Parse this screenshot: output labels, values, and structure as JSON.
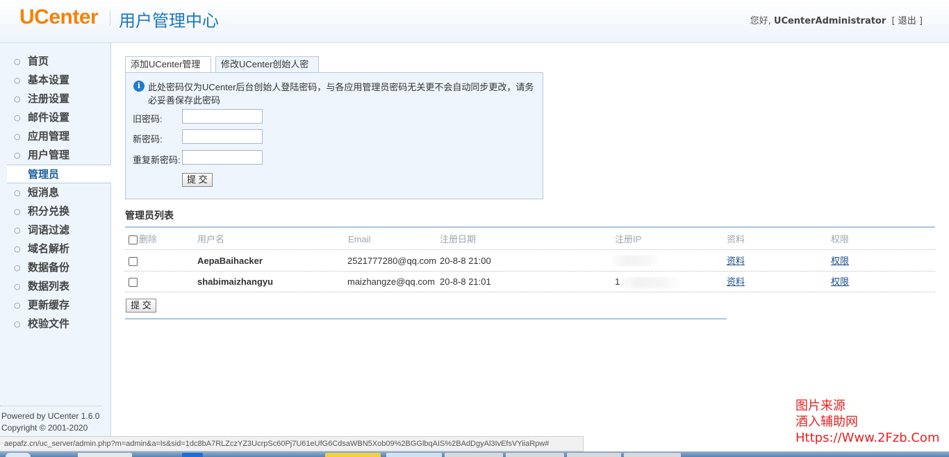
{
  "header": {
    "logo": "UCenter",
    "title": "用户管理中心",
    "greeting": "您好,",
    "username": "UCenterAdministrator",
    "logout_open": "[",
    "logout_label": "退出",
    "logout_close": "]"
  },
  "sidebar": {
    "items": [
      {
        "label": "首页"
      },
      {
        "label": "基本设置"
      },
      {
        "label": "注册设置"
      },
      {
        "label": "邮件设置"
      },
      {
        "label": "应用管理"
      },
      {
        "label": "用户管理"
      },
      {
        "label": "管理员",
        "active": true
      },
      {
        "label": "短消息"
      },
      {
        "label": "积分兑换"
      },
      {
        "label": "词语过滤"
      },
      {
        "label": "域名解析"
      },
      {
        "label": "数据备份"
      },
      {
        "label": "数据列表"
      },
      {
        "label": "更新缓存"
      },
      {
        "label": "校验文件"
      }
    ],
    "powered": "Powered by UCenter 1.6.0",
    "copyright": "Copyright © 2001-2020"
  },
  "tabs": {
    "add_admin": "添加UCenter管理员",
    "change_password": "修改UCenter创始人密码"
  },
  "password_form": {
    "notice": "此处密码仅为UCenter后台创始人登陆密码，与各应用管理员密码无关更不会自动同步更改，请务必妥善保存此密码",
    "old_label": "旧密码:",
    "old_value": "",
    "new_label": "新密码:",
    "new_value": "",
    "repeat_label": "重复新密码:",
    "repeat_value": "",
    "submit": "提 交"
  },
  "admin_list": {
    "title": "管理员列表",
    "columns": {
      "delete": "删除",
      "username": "用户名",
      "email": "Email",
      "regdate": "注册日期",
      "regip": "注册IP",
      "profile": "资料",
      "permission": "权限"
    },
    "rows": [
      {
        "username": "AepaBaihacker",
        "email": "2521777280@qq.com",
        "regdate": "20-8-8 21:00",
        "regip": "",
        "profile": "资料",
        "permission": "权限"
      },
      {
        "username": "shabimaizhangyu",
        "email": "maizhangze@qq.com",
        "regdate": "20-8-8 21:01",
        "regip": "1",
        "profile": "资料",
        "permission": "权限"
      }
    ],
    "submit": "提 交"
  },
  "watermark": {
    "line1": "图片来源",
    "line2": "酒入辅助网",
    "line3": "Https://Www.2Fzb.Com"
  },
  "statusbar": {
    "url": "aepafz.cn/uc_server/admin.php?m=admin&a=ls&sid=1dc8bA7RLZczYZ3UcrpSc60Pj7U61eUfG6CdsaWBN5Xob09%2BGGlbqAIS%2BAdDgyAl3IvEfsVYiiaRpw#"
  },
  "colors": {
    "logo": "#f5820a",
    "title": "#1a78c2",
    "sidebar_bg": "#eef5fc",
    "watermark": "#e52222",
    "link": "#1a4f8a"
  }
}
